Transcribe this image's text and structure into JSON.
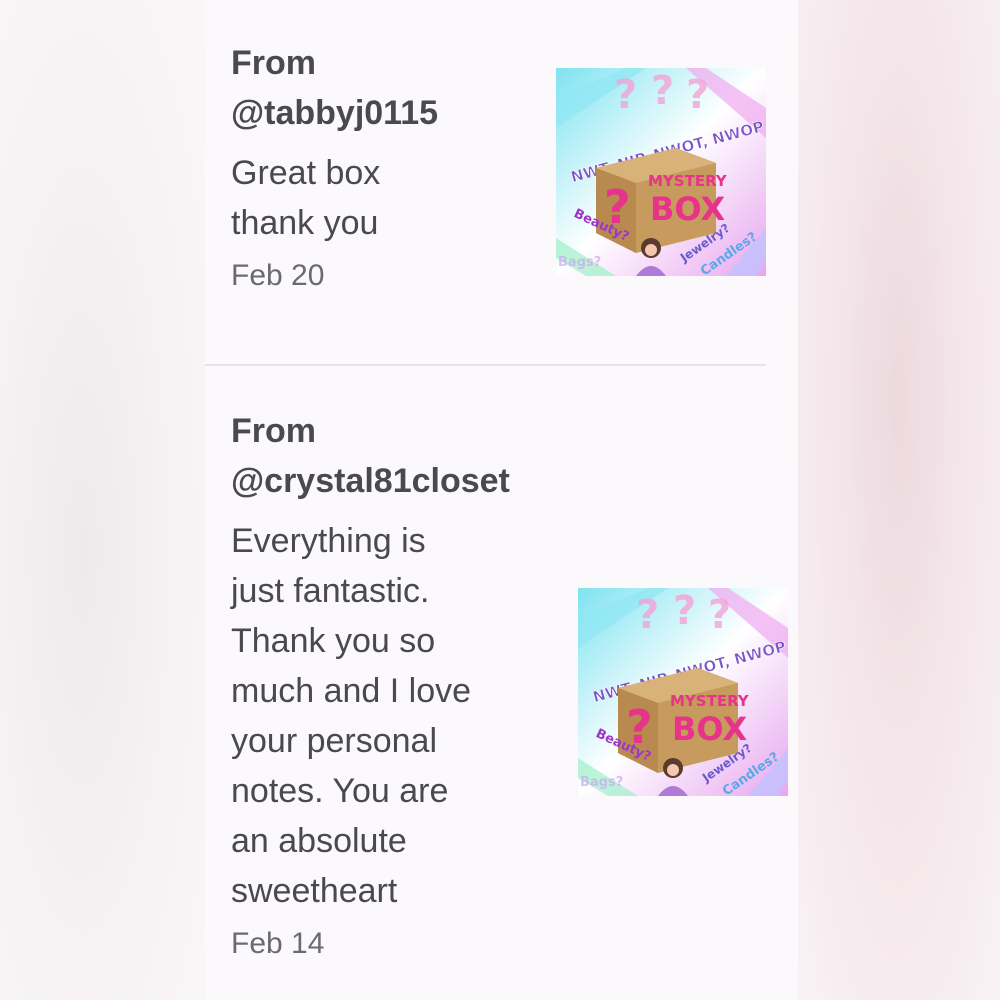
{
  "reviews": [
    {
      "from_label": "From",
      "username": "@tabbyj0115",
      "message_lines": [
        "Great box",
        "thank you"
      ],
      "date": "Feb 20",
      "thumbnail": {
        "banner": "NWT, NIP, NWOT, NWOP ITEMS",
        "title_top": "MYSTERY",
        "title_bottom": "BOX",
        "left_word": "Beauty?",
        "right_word": "Jewelry?",
        "right_word2": "Candles?",
        "bottom_left": "Bags?"
      }
    },
    {
      "from_label": "From",
      "username": "@crystal81closet",
      "message_lines": [
        "Everything is",
        "just fantastic.",
        "Thank you so",
        "much and I love",
        "your personal",
        "notes. You are",
        "an absolute",
        "sweetheart"
      ],
      "date": "Feb 14",
      "thumbnail": {
        "banner": "NWT, NIP, NWOT, NWOP ITEMS",
        "title_top": "MYSTERY",
        "title_bottom": "BOX",
        "left_word": "Beauty?",
        "right_word": "Jewelry?",
        "right_word2": "Candles?",
        "bottom_left": "Bags?"
      }
    }
  ],
  "colors": {
    "text": "#4a4a4c",
    "date": "#6b6b6d",
    "divider": "#e6e2e5",
    "box_brown": "#c79a5e",
    "mystery_pink": "#e8338a",
    "banner_purple": "#7b55c8"
  }
}
